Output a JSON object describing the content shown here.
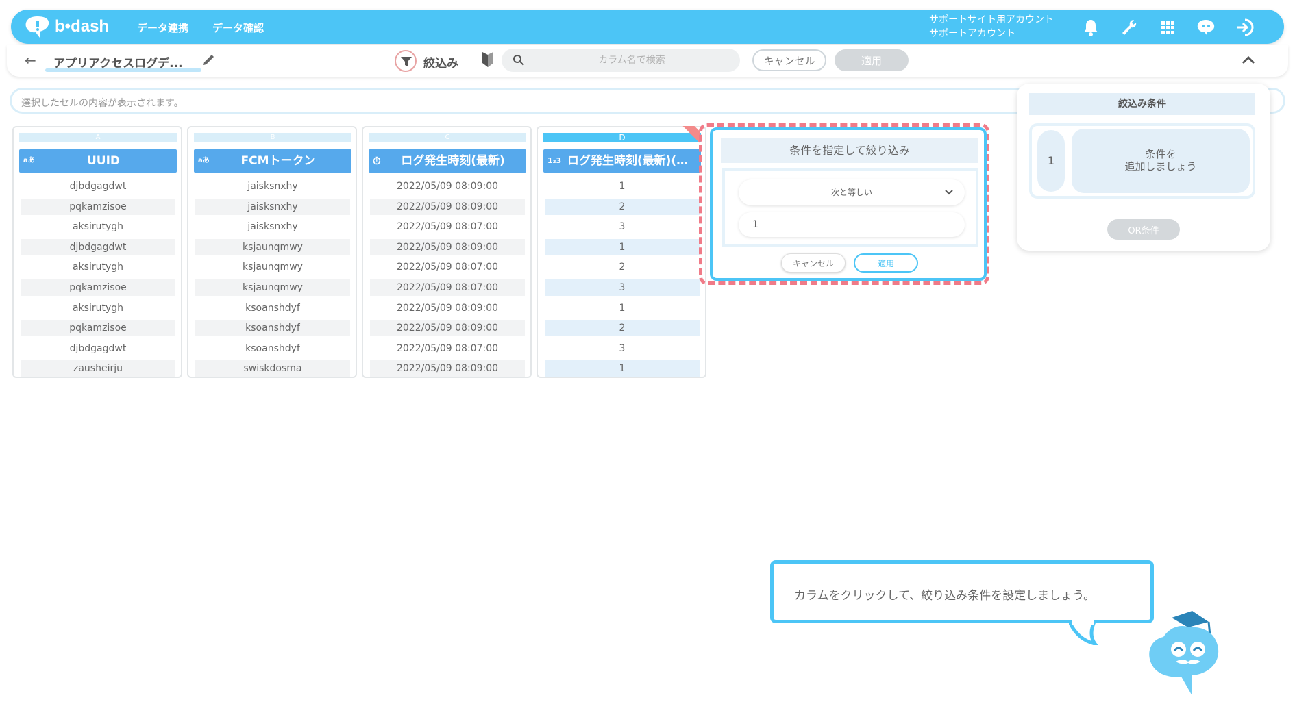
{
  "header": {
    "logo_text": "b•dash",
    "nav": [
      "データ連携",
      "データ確認"
    ],
    "account_line1": "サポートサイト用アカウント",
    "account_line2": "サポートアカウント",
    "icons": [
      "bell-icon",
      "wrench-icon",
      "grid-icon",
      "chat-icon",
      "logout-icon"
    ],
    "accent": "#4cc5f6"
  },
  "toolbar": {
    "title": "アプリアクセスログデ...",
    "filter_label": "絞込み",
    "search_placeholder": "カラム名で検索",
    "cancel_label": "キャンセル",
    "apply_label": "適用"
  },
  "cellbar": {
    "placeholder": "選択したセルの内容が表示されます。"
  },
  "columns": [
    {
      "letter": "A",
      "type": "aあ",
      "header": "UUID",
      "rows": [
        "djbdgagdwt",
        "pqkamzisoe",
        "aksirutygh",
        "djbdgagdwt",
        "aksirutygh",
        "pqkamzisoe",
        "aksirutygh",
        "pqkamzisoe",
        "djbdgagdwt",
        "zausheirju"
      ]
    },
    {
      "letter": "B",
      "type": "aあ",
      "header": "FCMトークン",
      "rows": [
        "jaisksnxhy",
        "jaisksnxhy",
        "jaisksnxhy",
        "ksjaunqmwy",
        "ksjaunqmwy",
        "ksjaunqmwy",
        "ksoanshdyf",
        "ksoanshdyf",
        "ksoanshdyf",
        "swiskdosma"
      ]
    },
    {
      "letter": "C",
      "type": "⏱",
      "header": "ログ発生時刻(最新)",
      "rows": [
        "2022/05/09 08:09:00",
        "2022/05/09 08:09:00",
        "2022/05/09 08:07:00",
        "2022/05/09 08:09:00",
        "2022/05/09 08:07:00",
        "2022/05/09 08:07:00",
        "2022/05/09 08:09:00",
        "2022/05/09 08:09:00",
        "2022/05/09 08:07:00",
        "2022/05/09 08:09:00"
      ]
    },
    {
      "letter": "D",
      "type": "1₂3",
      "header": "ログ発生時刻(最新)(…",
      "rows": [
        "1",
        "2",
        "3",
        "1",
        "2",
        "3",
        "1",
        "2",
        "3",
        "1"
      ]
    }
  ],
  "popup": {
    "title": "条件を指定して絞り込み",
    "operator": "次と等しい",
    "value": "1",
    "cancel_label": "キャンセル",
    "apply_label": "適用"
  },
  "filter_panel": {
    "title": "絞込み条件",
    "number": "1",
    "add_line1": "条件を",
    "add_line2": "追加しましょう",
    "or_label": "OR条件"
  },
  "hint": {
    "text": "カラムをクリックして、絞り込み条件を設定しましょう。"
  }
}
